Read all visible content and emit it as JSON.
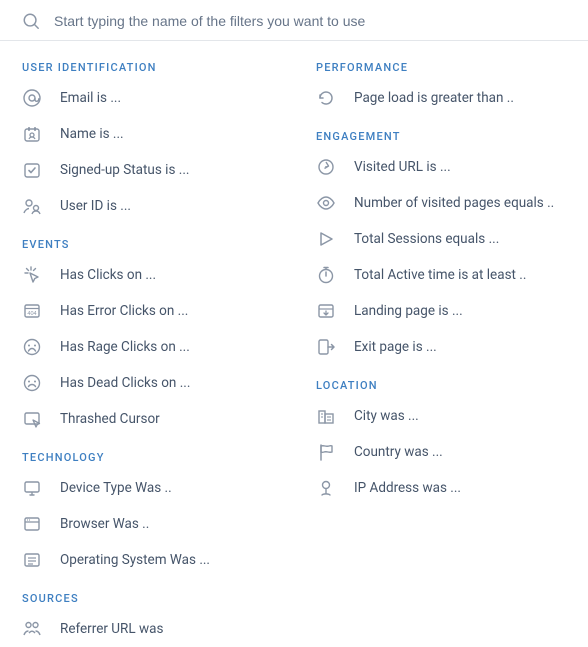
{
  "search": {
    "placeholder": "Start typing the name of the filters you want to use",
    "value": ""
  },
  "left": [
    {
      "title": "USER IDENTIFICATION",
      "items": [
        {
          "icon": "at-icon",
          "label": "Email is ..."
        },
        {
          "icon": "name-icon",
          "label": "Name is ..."
        },
        {
          "icon": "signup-icon",
          "label": "Signed-up Status is ..."
        },
        {
          "icon": "userid-icon",
          "label": "User ID is ..."
        }
      ]
    },
    {
      "title": "EVENTS",
      "items": [
        {
          "icon": "clicks-icon",
          "label": "Has Clicks on ..."
        },
        {
          "icon": "error-clicks-icon",
          "label": "Has Error Clicks on ..."
        },
        {
          "icon": "rage-clicks-icon",
          "label": "Has Rage Clicks on ..."
        },
        {
          "icon": "dead-clicks-icon",
          "label": "Has Dead Clicks on ..."
        },
        {
          "icon": "thrashed-cursor-icon",
          "label": "Thrashed Cursor"
        }
      ]
    },
    {
      "title": "TECHNOLOGY",
      "items": [
        {
          "icon": "device-icon",
          "label": "Device Type Was .."
        },
        {
          "icon": "browser-icon",
          "label": "Browser Was .."
        },
        {
          "icon": "os-icon",
          "label": "Operating System Was ..."
        }
      ]
    },
    {
      "title": "SOURCES",
      "items": [
        {
          "icon": "referrer-icon",
          "label": "Referrer URL was"
        }
      ]
    }
  ],
  "right": [
    {
      "title": "PERFORMANCE",
      "items": [
        {
          "icon": "load-icon",
          "label": "Page load is greater than .."
        }
      ]
    },
    {
      "title": "ENGAGEMENT",
      "items": [
        {
          "icon": "visited-url-icon",
          "label": "Visited URL is ..."
        },
        {
          "icon": "eye-icon",
          "label": "Number of visited pages equals .."
        },
        {
          "icon": "play-icon",
          "label": "Total Sessions equals ..."
        },
        {
          "icon": "stopwatch-icon",
          "label": "Total Active time is at least .."
        },
        {
          "icon": "landing-icon",
          "label": "Landing page is ..."
        },
        {
          "icon": "exit-icon",
          "label": "Exit page is ..."
        }
      ]
    },
    {
      "title": "LOCATION",
      "items": [
        {
          "icon": "city-icon",
          "label": "City was ..."
        },
        {
          "icon": "flag-icon",
          "label": "Country was ..."
        },
        {
          "icon": "ip-icon",
          "label": "IP Address was ..."
        }
      ]
    }
  ]
}
